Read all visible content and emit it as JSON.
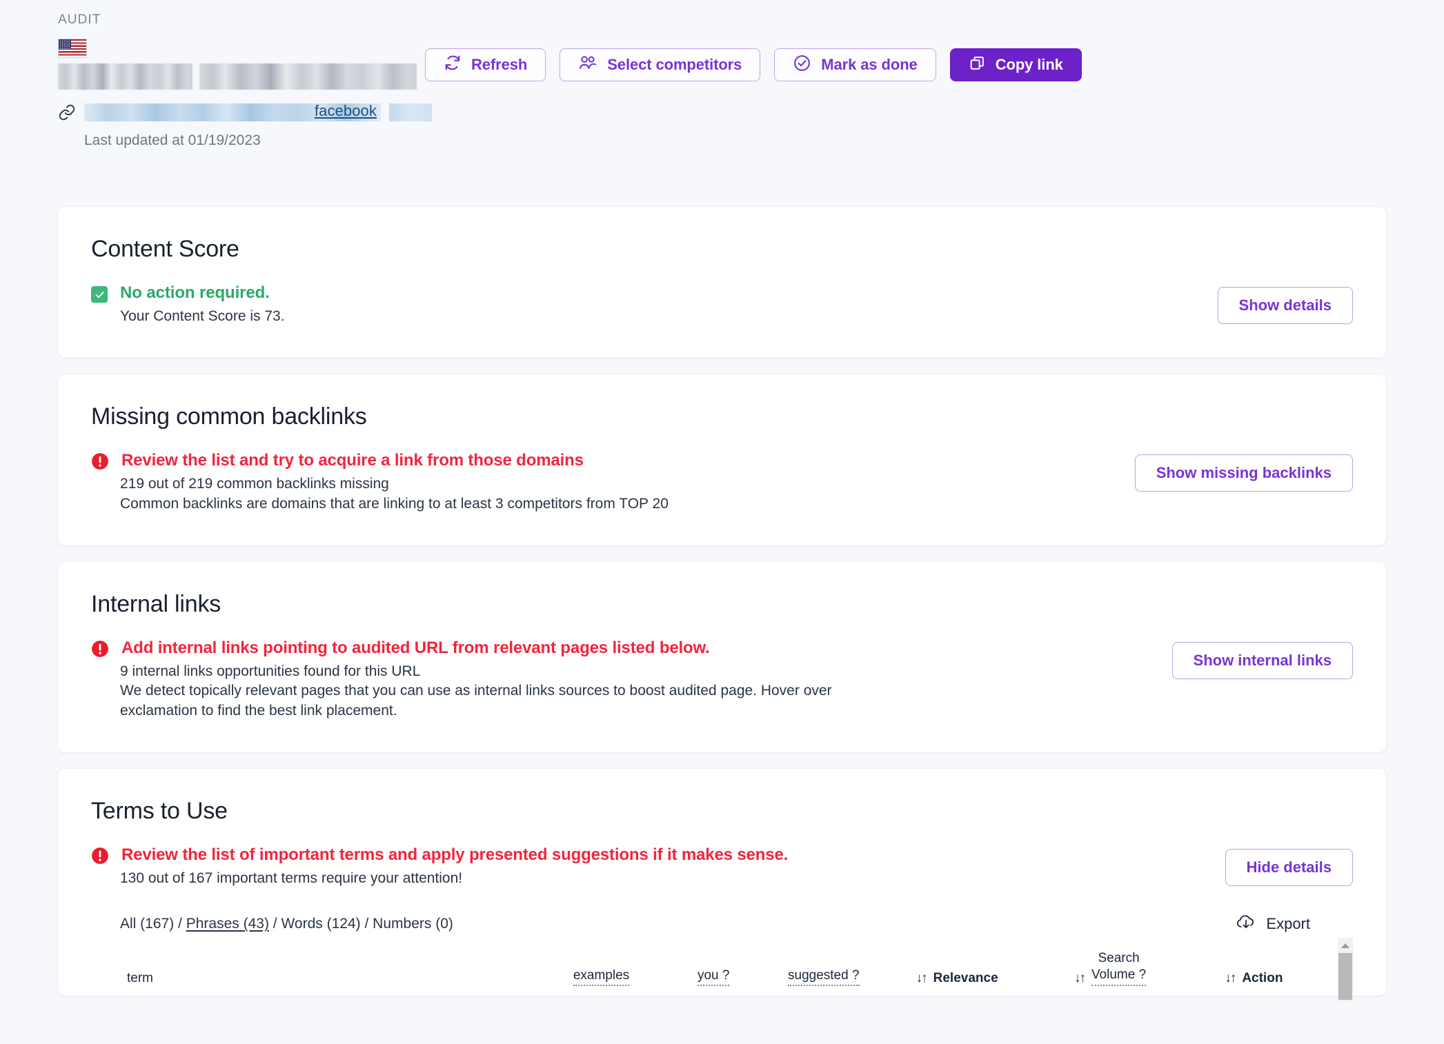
{
  "header": {
    "section_label": "AUDIT",
    "flag_icon": "us-flag-icon",
    "link_icon": "link-icon",
    "site_link_text": "facebook",
    "last_updated": "Last updated at 01/19/2023",
    "actions": [
      {
        "label": "Refresh",
        "icon": "refresh-icon",
        "style": "outline"
      },
      {
        "label": "Select competitors",
        "icon": "users-icon",
        "style": "outline"
      },
      {
        "label": "Mark as done",
        "icon": "check-circle-icon",
        "style": "outline"
      },
      {
        "label": "Copy link",
        "icon": "copy-icon",
        "style": "primary"
      }
    ]
  },
  "colors": {
    "accent_purple": "#7734d6",
    "primary_purple": "#6d21c8",
    "alert_red": "#f4243c",
    "success_green": "#2aa96a",
    "page_bg": "#f7f8fb"
  },
  "content_score": {
    "title": "Content Score",
    "status_icon": "check-square-icon",
    "headline": "No action required.",
    "detail": "Your Content Score is 73.",
    "button": "Show details"
  },
  "missing_backlinks": {
    "title": "Missing common backlinks",
    "status_icon": "alert-circle-icon",
    "headline": "Review the list and try to acquire a link from those domains",
    "detail_1": "219 out of 219 common backlinks missing",
    "detail_2": "Common backlinks are domains that are linking to at least 3 competitors from TOP 20",
    "button": "Show missing backlinks"
  },
  "internal_links": {
    "title": "Internal links",
    "status_icon": "alert-circle-icon",
    "headline": "Add internal links pointing to audited URL from relevant pages listed below.",
    "detail_1": "9 internal links opportunities found for this URL",
    "detail_2": "We detect topically relevant pages that you can use as internal links sources to boost audited page. Hover over exclamation to find the best link placement.",
    "button": "Show internal links"
  },
  "terms_to_use": {
    "title": "Terms to Use",
    "status_icon": "alert-circle-icon",
    "headline": "Review the list of important terms and apply presented suggestions if it makes sense.",
    "detail_1": "130 out of 167 important terms require your attention!",
    "button": "Hide details",
    "filters": [
      {
        "label": "All (167)",
        "active": false
      },
      {
        "label": "Phrases (43)",
        "active": true
      },
      {
        "label": "Words (124)",
        "active": false
      },
      {
        "label": "Numbers (0)",
        "active": false
      }
    ],
    "filter_separator": "/",
    "export": {
      "label": "Export",
      "icon": "cloud-download-icon"
    },
    "table": {
      "columns": [
        {
          "key": "term",
          "label": "term",
          "hint": false,
          "sortable": false
        },
        {
          "key": "examples",
          "label": "examples",
          "hint": true,
          "sortable": false
        },
        {
          "key": "you",
          "label": "you ?",
          "hint": true,
          "sortable": false
        },
        {
          "key": "suggested",
          "label": "suggested ?",
          "hint": true,
          "sortable": false
        },
        {
          "key": "relevance",
          "label": "Relevance",
          "hint": false,
          "sortable": true
        },
        {
          "key": "search_volume_line1",
          "label": "Search",
          "line2": "Volume ?",
          "hint": true,
          "sortable": true
        },
        {
          "key": "action",
          "label": "Action",
          "hint": false,
          "sortable": true
        }
      ],
      "sort_icon": "sort-arrows-icon",
      "rows": []
    }
  },
  "scrollbar": {
    "up_arrow_icon": "triangle-up-icon"
  }
}
